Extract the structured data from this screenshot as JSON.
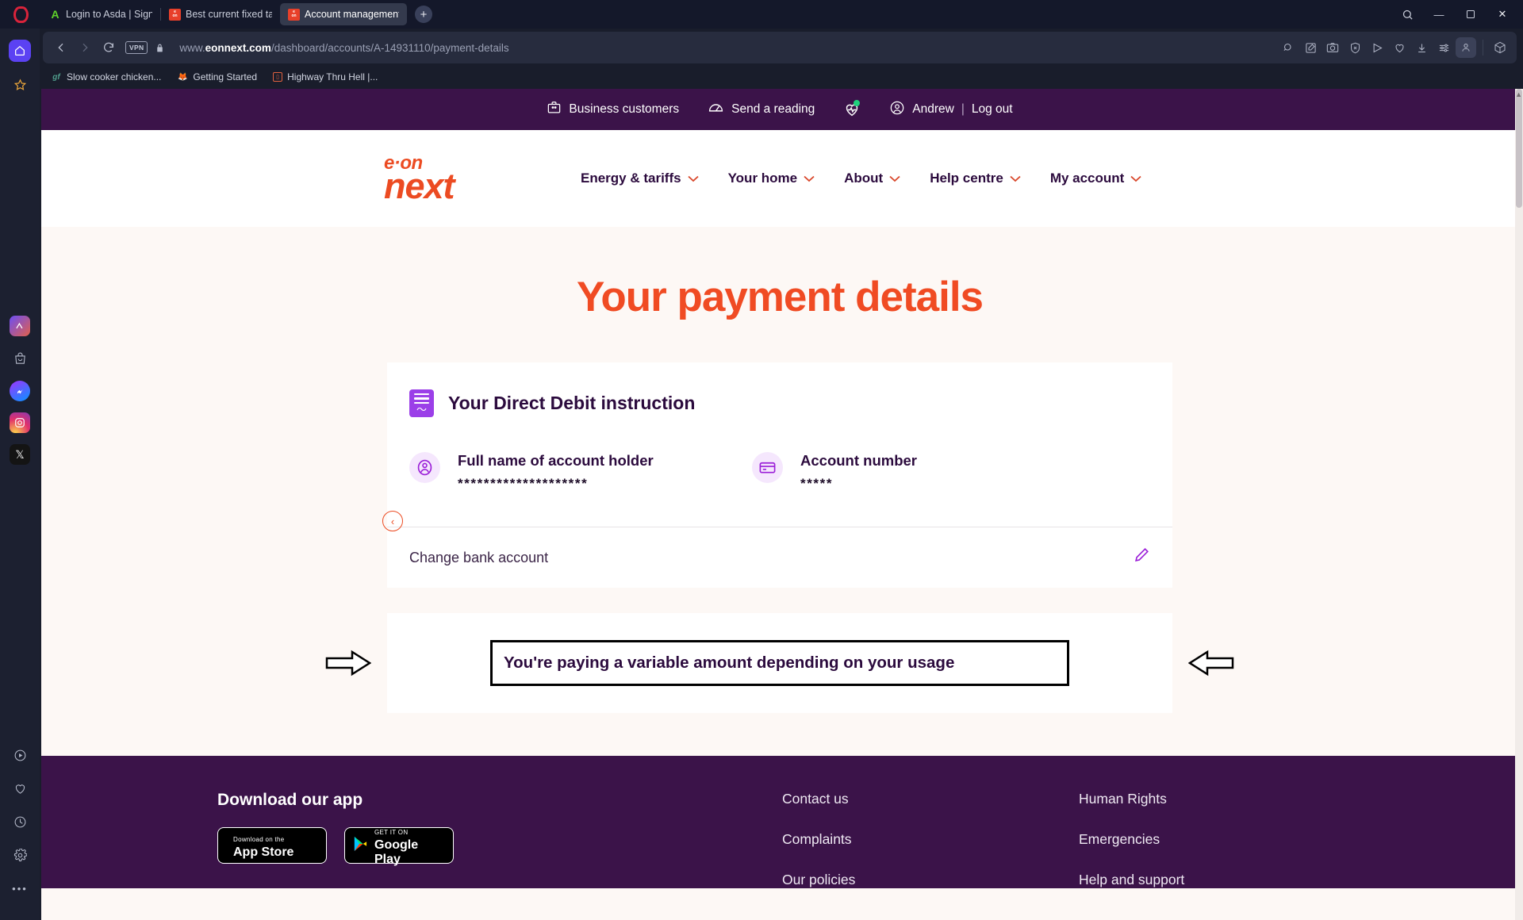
{
  "browser": {
    "tabs": [
      {
        "title": "Login to Asda | Sign in to",
        "favicon": "asda-icon",
        "active": false
      },
      {
        "title": "Best current fixed tariffs?",
        "favicon": "eonnext-icon",
        "active": false
      },
      {
        "title": "Account management | Pa",
        "favicon": "eonnext-icon",
        "active": true
      }
    ],
    "new_tab_label": "+",
    "window_controls": {
      "minimize": "—",
      "maximize": "❐",
      "close": "✕"
    },
    "nav": {
      "back": "‹",
      "forward": "›",
      "reload": "⟳",
      "vpn_badge": "VPN",
      "lock_icon": "padlock-icon",
      "url_prefix": "www.",
      "url_domain": "eonnext.com",
      "url_path": "/dashboard/accounts/A-14931110/payment-details"
    },
    "toolbar_icons": [
      "search-icon",
      "edit-note-icon",
      "screenshot-icon",
      "shield-block-icon",
      "send-icon",
      "heart-icon",
      "download-icon",
      "easy-setup-icon",
      "profile-icon",
      "extensions-icon"
    ],
    "bookmarks": [
      {
        "label": "Slow cooker chicken...",
        "icon": "goodfood-icon"
      },
      {
        "label": "Getting Started",
        "icon": "firefox-icon"
      },
      {
        "label": "Highway Thru Hell |...",
        "icon": "generic-icon"
      }
    ],
    "rail": {
      "top": [
        "opera-logo",
        "home-icon",
        "bookmark-icon"
      ],
      "apps": [
        "youtube-music-icon",
        "shopping-bag-icon",
        "messenger-icon",
        "instagram-icon",
        "x-icon"
      ],
      "bottom": [
        "player-icon",
        "favourites-icon",
        "history-icon",
        "settings-icon",
        "more-icon"
      ]
    }
  },
  "site": {
    "topbar": {
      "business": "Business customers",
      "reading": "Send a reading",
      "heart_badge": "pulse-heart-icon",
      "user": "Andrew",
      "separator": "|",
      "logout": "Log out"
    },
    "logo": {
      "line1": "e·on",
      "line2": "next"
    },
    "nav_items": [
      {
        "label": "Energy & tariffs",
        "caret": "⌄"
      },
      {
        "label": "Your home",
        "caret": "⌄"
      },
      {
        "label": "About",
        "caret": "⌄"
      },
      {
        "label": "Help centre",
        "caret": "⌄"
      },
      {
        "label": "My account",
        "caret": "⌄"
      }
    ],
    "back_button": "‹",
    "page_title": "Your payment details",
    "dd_card": {
      "heading": "Your Direct Debit instruction",
      "fields": [
        {
          "label": "Full name of account holder",
          "value": "********************",
          "icon": "person-circle-icon"
        },
        {
          "label": "Account number",
          "value": "*****",
          "icon": "credit-card-icon"
        }
      ],
      "change_row": {
        "label": "Change bank account",
        "icon": "pencil-icon"
      }
    },
    "payment_note": {
      "text": "You're paying a variable amount depending on your usage",
      "annotation_left": "left-arrow-annotation",
      "annotation_right": "right-arrow-annotation"
    },
    "footer": {
      "app_heading": "Download our app",
      "app_store": {
        "small": "Download on the",
        "big": "App Store"
      },
      "google_play": {
        "small": "GET IT ON",
        "big": "Google Play"
      },
      "column_1": [
        "Contact us",
        "Complaints",
        "Our policies"
      ],
      "column_2": [
        "Human Rights",
        "Emergencies",
        "Help and support"
      ]
    }
  },
  "colors": {
    "brand_orange": "#f04b23",
    "brand_purple": "#3b1349",
    "accent_violet": "#9b1fd8",
    "page_bg": "#fdf8f5",
    "chrome_bg": "#191d2b"
  }
}
